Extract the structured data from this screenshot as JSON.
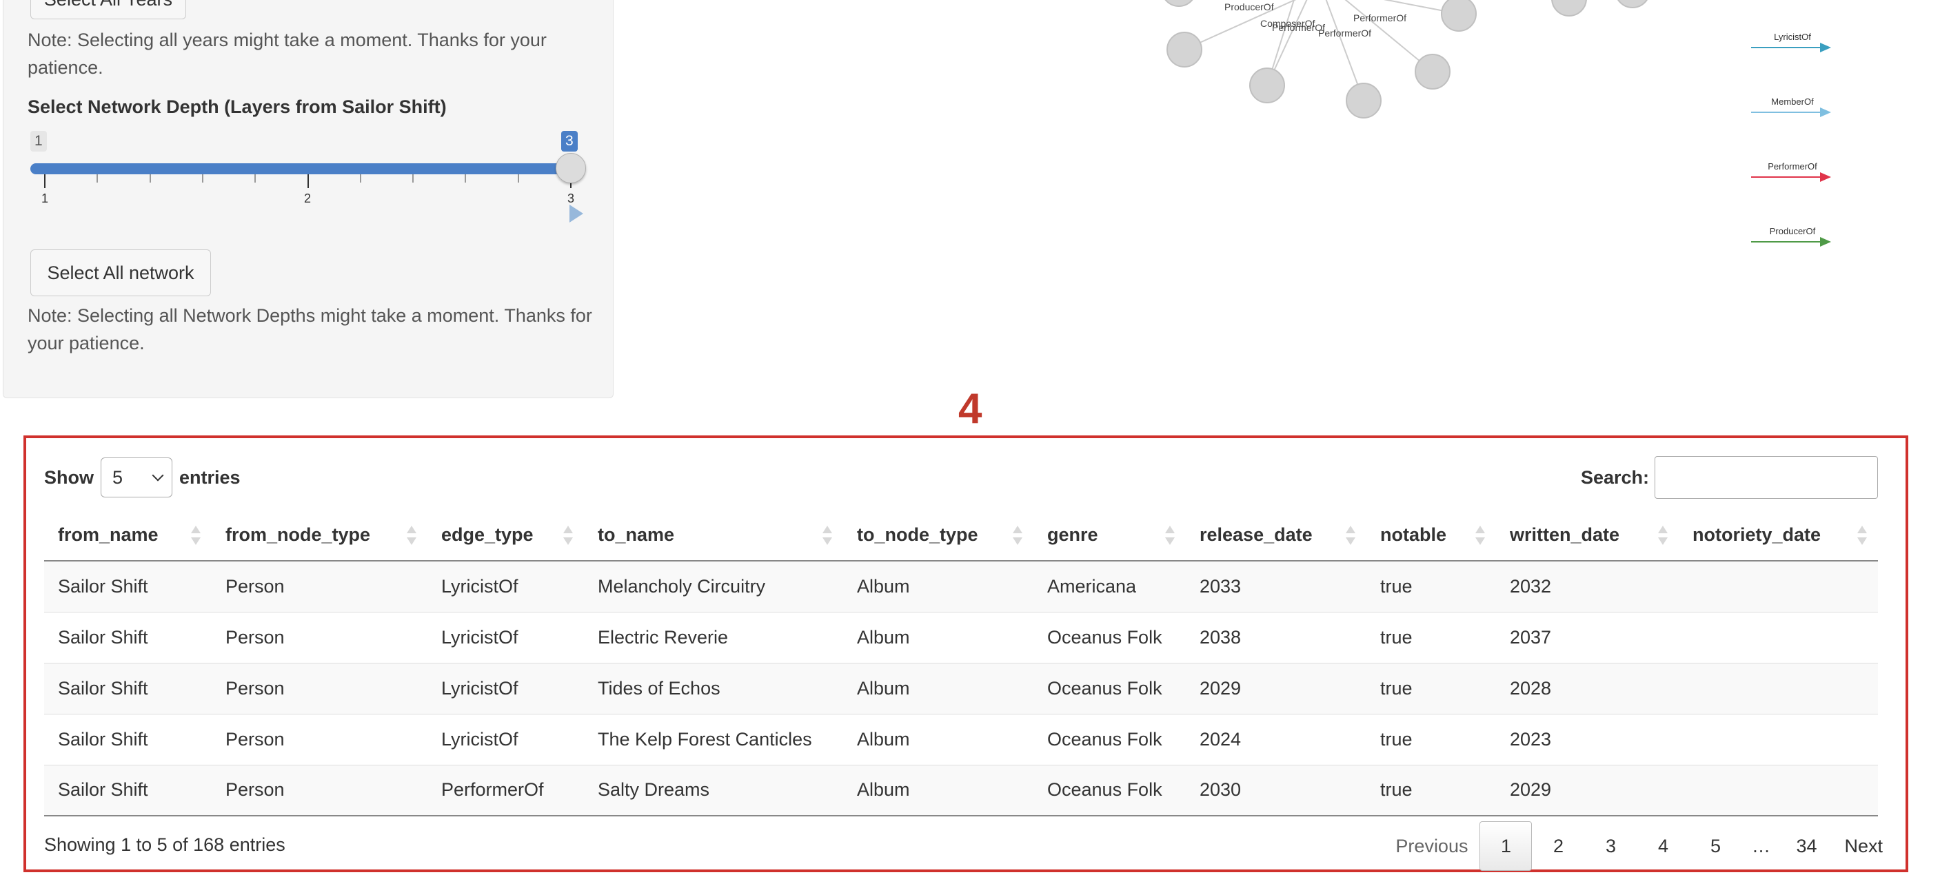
{
  "sidebar": {
    "select_all_years_label": "Select All Years",
    "years_note": "Note: Selecting all years might take a moment. Thanks for your patience.",
    "depth_label": "Select Network Depth (Layers from Sailor Shift)",
    "slider": {
      "min": "1",
      "max": "3",
      "value": "3",
      "tick_labels": [
        "1",
        "2",
        "3"
      ]
    },
    "select_all_network_label": "Select All network",
    "network_note": "Note: Selecting all Network Depths might take a moment. Thanks for your patience."
  },
  "network": {
    "edge_labels": [
      "ProducerOf",
      "ComposerOf",
      "PerformerOf",
      "PerformerOf",
      "PerformerOf"
    ],
    "legend": [
      {
        "label": "LyricistOf",
        "color": "#3a9fc0"
      },
      {
        "label": "MemberOf",
        "color": "#7fbfe0"
      },
      {
        "label": "PerformerOf",
        "color": "#e0344a"
      },
      {
        "label": "ProducerOf",
        "color": "#4f9a47"
      }
    ]
  },
  "marker": "4",
  "table": {
    "show_label": "Show",
    "entries_label": "entries",
    "page_size": "5",
    "search_label": "Search:",
    "search_value": "",
    "columns": [
      "from_name",
      "from_node_type",
      "edge_type",
      "to_name",
      "to_node_type",
      "genre",
      "release_date",
      "notable",
      "written_date",
      "notoriety_date"
    ],
    "rows": [
      [
        "Sailor Shift",
        "Person",
        "LyricistOf",
        "Melancholy Circuitry",
        "Album",
        "Americana",
        "2033",
        "true",
        "2032",
        ""
      ],
      [
        "Sailor Shift",
        "Person",
        "LyricistOf",
        "Electric Reverie",
        "Album",
        "Oceanus Folk",
        "2038",
        "true",
        "2037",
        ""
      ],
      [
        "Sailor Shift",
        "Person",
        "LyricistOf",
        "Tides of Echos",
        "Album",
        "Oceanus Folk",
        "2029",
        "true",
        "2028",
        ""
      ],
      [
        "Sailor Shift",
        "Person",
        "LyricistOf",
        "The Kelp Forest Canticles",
        "Album",
        "Oceanus Folk",
        "2024",
        "true",
        "2023",
        ""
      ],
      [
        "Sailor Shift",
        "Person",
        "PerformerOf",
        "Salty Dreams",
        "Album",
        "Oceanus Folk",
        "2030",
        "true",
        "2029",
        ""
      ]
    ],
    "info": "Showing 1 to 5 of 168 entries",
    "pagination": {
      "previous": "Previous",
      "pages": [
        "1",
        "2",
        "3",
        "4",
        "5",
        "…",
        "34"
      ],
      "current": "1",
      "next": "Next"
    }
  },
  "colors": {
    "accent": "#4a7fc7",
    "highlight_border": "#d0312d"
  }
}
